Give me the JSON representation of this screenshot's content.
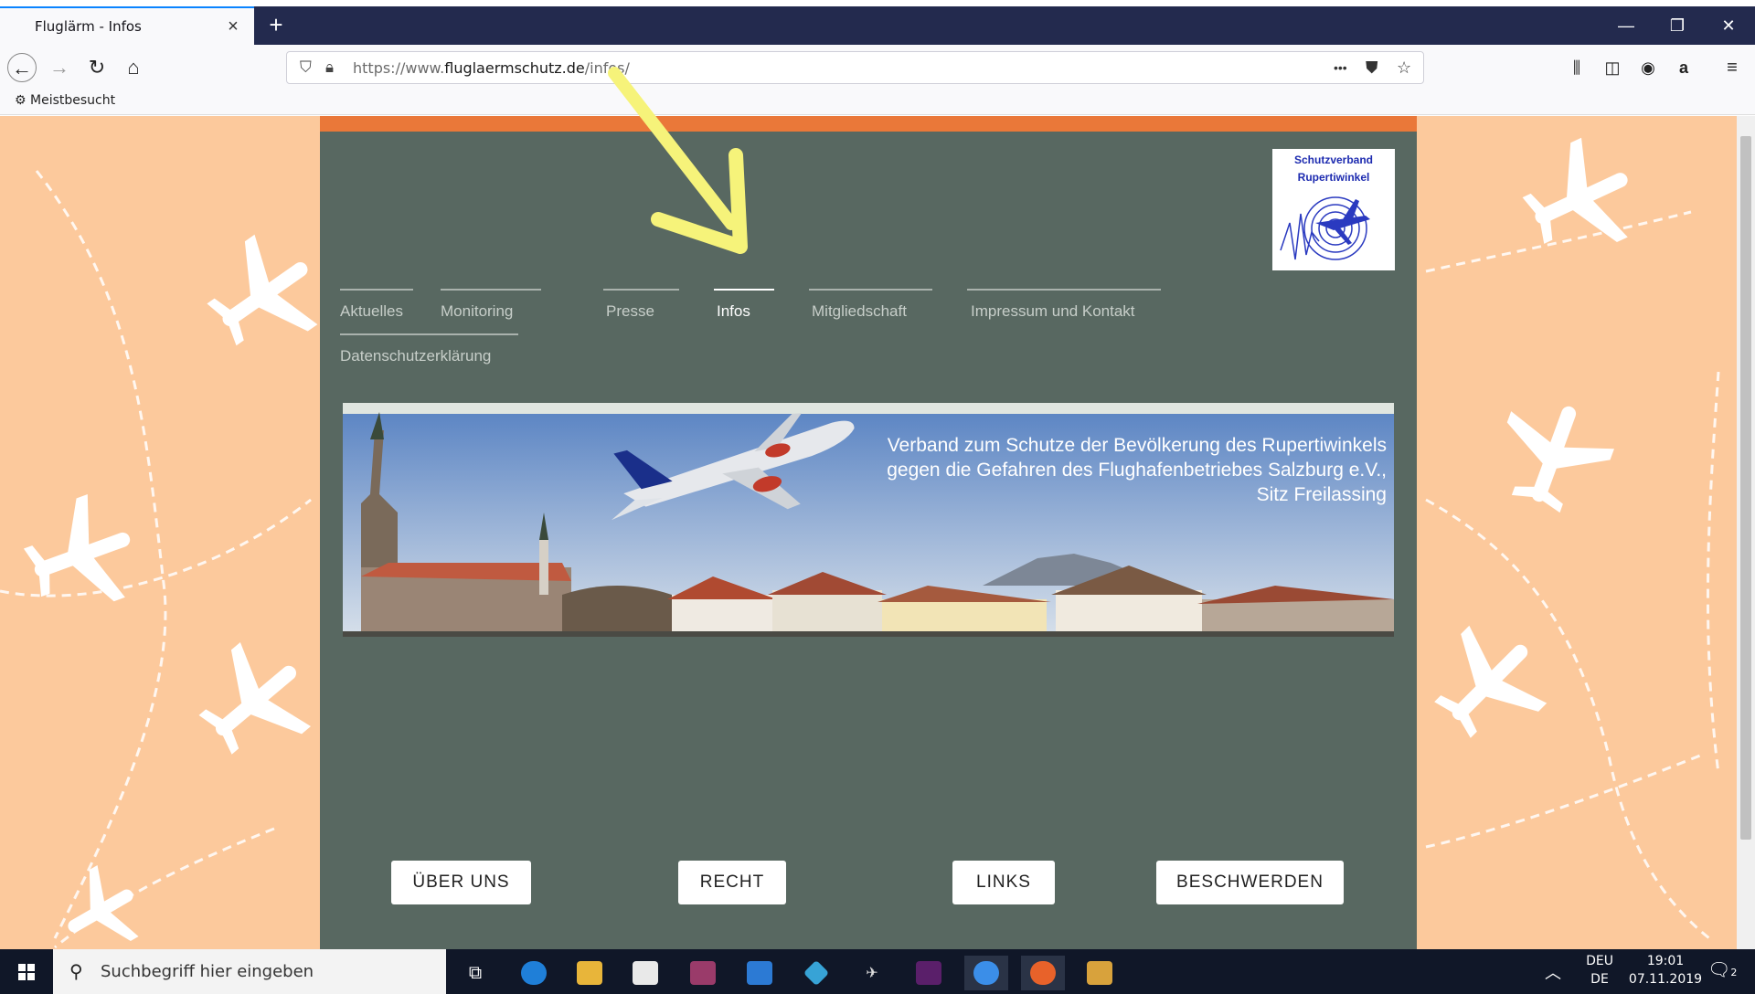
{
  "browser": {
    "tab_title": "Fluglärm - Infos",
    "tab_close": "×",
    "new_tab": "+",
    "url_prefix": "https://www.",
    "url_domain": "fluglaermschutz.de",
    "url_path": "/infos/",
    "url_more": "•••",
    "bookmark": "Meistbesucht"
  },
  "site": {
    "logo_line1": "Schutzverband",
    "logo_line2": "Rupertiwinkel",
    "menu": [
      {
        "label": "Aktuelles",
        "active": false
      },
      {
        "label": "Monitoring",
        "active": false
      },
      {
        "label": "Presse",
        "active": false
      },
      {
        "label": "Infos",
        "active": true
      },
      {
        "label": "Mitgliedschaft",
        "active": false
      },
      {
        "label": "Impressum und Kontakt",
        "active": false
      },
      {
        "label": "Datenschutzerklärung",
        "active": false
      }
    ],
    "banner_text": [
      "Verband zum Schutze der Bevölkerung des Rupertiwinkels",
      "gegen die Gefahren des Flughafenbetriebes Salzburg e.V.,",
      "Sitz Freilassing"
    ],
    "buttons": [
      "ÜBER UNS",
      "RECHT",
      "LINKS",
      "BESCHWERDEN"
    ],
    "colors": {
      "background": "#fcc99c",
      "content": "#586861",
      "accent": "#ea7839"
    }
  },
  "taskbar": {
    "search_placeholder": "Suchbegriff hier eingeben",
    "lang_top": "DEU",
    "lang_bottom": "DE",
    "time": "19:01",
    "date": "07.11.2019",
    "notifications": "2"
  }
}
